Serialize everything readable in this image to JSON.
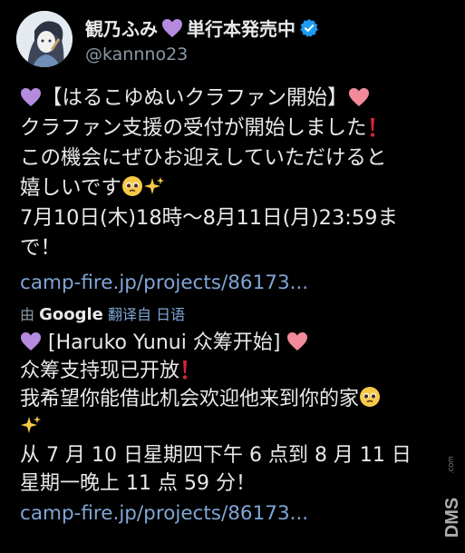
{
  "author": {
    "display_name": "観乃ふみ",
    "name_suffix": "単行本発売中",
    "handle": "@kannno23"
  },
  "tweet": {
    "line1": "【はるこゆぬいクラファン開始】",
    "line2": "クラファン支援の受付が開始しました",
    "line3": "この機会にぜひお迎えしていただけると",
    "line4": "嬉しいです",
    "line5": "7月10日(木)18時〜8月11日(月)23:59ま",
    "line6": "で！",
    "link": "camp-fire.jp/projects/86173..."
  },
  "translation_bar": {
    "prefix": "由",
    "provider": "Google",
    "translated_from": "翻译自",
    "language": "日语"
  },
  "translation": {
    "line1": "[Haruko Yunui 众筹开始]",
    "line2": "众筹支持现已开放",
    "line3": "我希望你能借此机会欢迎他来到你的家",
    "line5": "从 7 月 10 日星期四下午 6 点到 8 月 11 日",
    "line6": "星期一晚上 11 点 59 分！",
    "link": "camp-fire.jp/projects/86173..."
  },
  "watermark": {
    "text": "DMS",
    "suffix": ".com"
  },
  "colors": {
    "background": "#000000",
    "text": "#e7e9ea",
    "muted": "#8b98a5",
    "link": "#7fa6d6",
    "purple_heart": "#b58be0",
    "pink_heart": "#f28a9c",
    "exclamation": "#d6263a",
    "verified_badge": "#1d9bf0",
    "crown_heart": "#b58be0"
  },
  "icons": [
    "purple-heart-icon",
    "pink-heart-icon",
    "verified-badge-icon",
    "red-exclamation-icon",
    "pleading-face-icon",
    "sparkles-icon",
    "avatar-image"
  ]
}
